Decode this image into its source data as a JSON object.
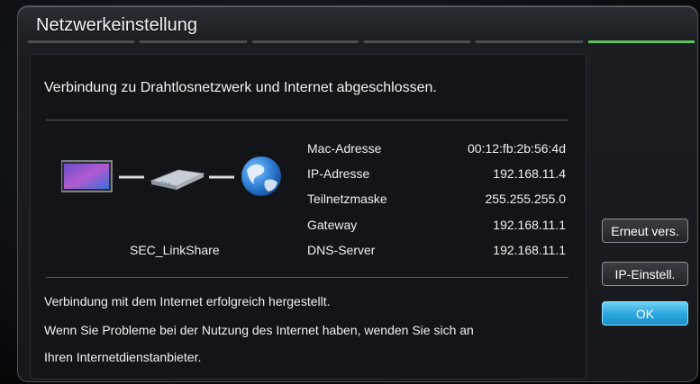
{
  "dialog": {
    "title": "Netzwerkeinstellung",
    "steps_total": 6,
    "step_active": 6
  },
  "panel": {
    "headline": "Verbindung zu Drahtlosnetzwerk und Internet abgeschlossen.",
    "device_name": "SEC_LinkShare",
    "info": [
      {
        "label": "Mac-Adresse",
        "value": "00:12:fb:2b:56:4d"
      },
      {
        "label": "IP-Adresse",
        "value": "192.168.11.4"
      },
      {
        "label": "Teilnetzmaske",
        "value": "255.255.255.0"
      },
      {
        "label": "Gateway",
        "value": "192.168.11.1"
      },
      {
        "label": "DNS-Server",
        "value": "192.168.11.1"
      }
    ],
    "message_line1": "Verbindung mit dem Internet erfolgreich hergestellt.",
    "message_line2": "Wenn Sie Probleme bei der Nutzung des Internet haben, wenden Sie sich an",
    "message_line3": "Ihren Internetdienstanbieter."
  },
  "buttons": {
    "retry": "Erneut vers.",
    "ip_settings": "IP-Einstell.",
    "ok": "OK"
  },
  "icons": {
    "tv": "tv-icon",
    "router": "router-icon",
    "globe": "globe-icon"
  },
  "colors": {
    "accent_green": "#5ec35b",
    "ok_blue": "#2aa6dd"
  }
}
